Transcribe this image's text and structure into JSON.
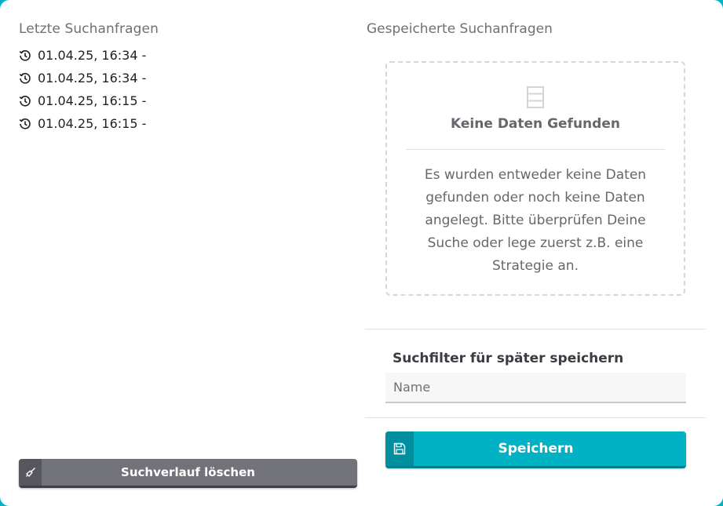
{
  "recent": {
    "title": "Letzte Suchanfragen",
    "items": [
      {
        "label": "01.04.25, 16:34 -"
      },
      {
        "label": "01.04.25, 16:34 -"
      },
      {
        "label": "01.04.25, 16:15 -"
      },
      {
        "label": "01.04.25, 16:15 -"
      }
    ],
    "clear_label": "Suchverlauf löschen"
  },
  "saved": {
    "title": "Gespeicherte Suchanfragen",
    "empty_title": "Keine Daten Gefunden",
    "empty_text": "Es wurden entweder keine Daten gefunden oder noch keine Daten angelegt. Bitte überprüfen Deine Suche oder lege zuerst z.B. eine Strategie an."
  },
  "save_filter": {
    "label": "Suchfilter für später speichern",
    "name_placeholder": "Name",
    "name_value": "",
    "save_label": "Speichern"
  },
  "colors": {
    "accent": "#00b2c4",
    "secondary_button": "#71727a"
  }
}
